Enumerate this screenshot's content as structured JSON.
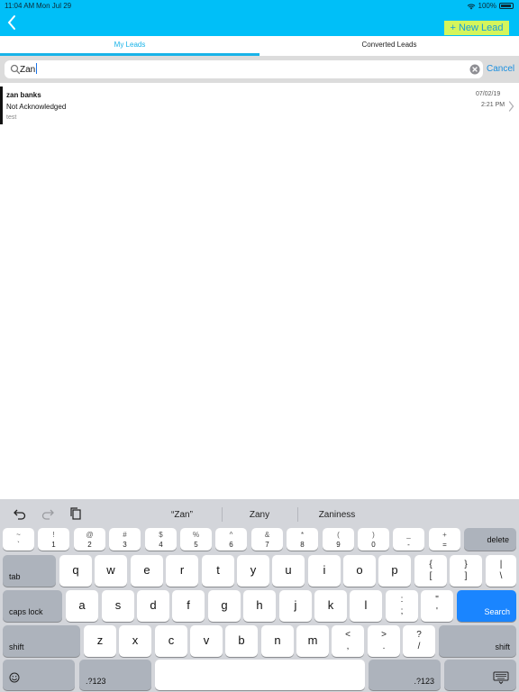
{
  "status": {
    "time": "11:04 AM",
    "date": "Mon Jul 29",
    "battery": "100%"
  },
  "header": {
    "new_lead_label": "+ New Lead"
  },
  "tabs": [
    {
      "label": "My Leads"
    },
    {
      "label": "Converted Leads"
    }
  ],
  "search": {
    "value": "Zan",
    "cancel_label": "Cancel"
  },
  "leads": [
    {
      "name": "zan banks",
      "status": "Not Acknowledged",
      "note": "test",
      "date": "07/02/19",
      "time": "2:21 PM"
    }
  ],
  "keyboard": {
    "suggestions": [
      "“Zan”",
      "Zany",
      "Zaniness"
    ],
    "number_row": [
      {
        "top": "~",
        "bottom": "`"
      },
      {
        "top": "!",
        "bottom": "1"
      },
      {
        "top": "@",
        "bottom": "2"
      },
      {
        "top": "#",
        "bottom": "3"
      },
      {
        "top": "$",
        "bottom": "4"
      },
      {
        "top": "%",
        "bottom": "5"
      },
      {
        "top": "^",
        "bottom": "6"
      },
      {
        "top": "&",
        "bottom": "7"
      },
      {
        "top": "*",
        "bottom": "8"
      },
      {
        "top": "(",
        "bottom": "9"
      },
      {
        "top": ")",
        "bottom": "0"
      },
      {
        "top": "_",
        "bottom": "-"
      },
      {
        "top": "+",
        "bottom": "="
      }
    ],
    "delete_label": "delete",
    "tab_label": "tab",
    "row_q": [
      "q",
      "w",
      "e",
      "r",
      "t",
      "y",
      "u",
      "i",
      "o",
      "p"
    ],
    "row_q_symbols": [
      {
        "top": "{",
        "bottom": "["
      },
      {
        "top": "}",
        "bottom": "]"
      },
      {
        "top": "|",
        "bottom": "\\"
      }
    ],
    "caps_label": "caps lock",
    "row_a": [
      "a",
      "s",
      "d",
      "f",
      "g",
      "h",
      "j",
      "k",
      "l"
    ],
    "row_a_symbols": [
      {
        "top": ":",
        "bottom": ";"
      },
      {
        "top": "\"",
        "bottom": "'"
      }
    ],
    "search_label": "Search",
    "shift_label": "shift",
    "row_z": [
      "z",
      "x",
      "c",
      "v",
      "b",
      "n",
      "m"
    ],
    "row_z_symbols": [
      {
        "top": "<",
        "bottom": ","
      },
      {
        "top": ">",
        "bottom": "."
      },
      {
        "top": "?",
        "bottom": "/"
      }
    ],
    "numbers_label": ".?123",
    "icons": {
      "undo": "undo-icon",
      "redo": "redo-icon",
      "paste": "paste-icon",
      "emoji": "emoji-icon",
      "dismiss": "keyboard-dismiss-icon"
    }
  }
}
